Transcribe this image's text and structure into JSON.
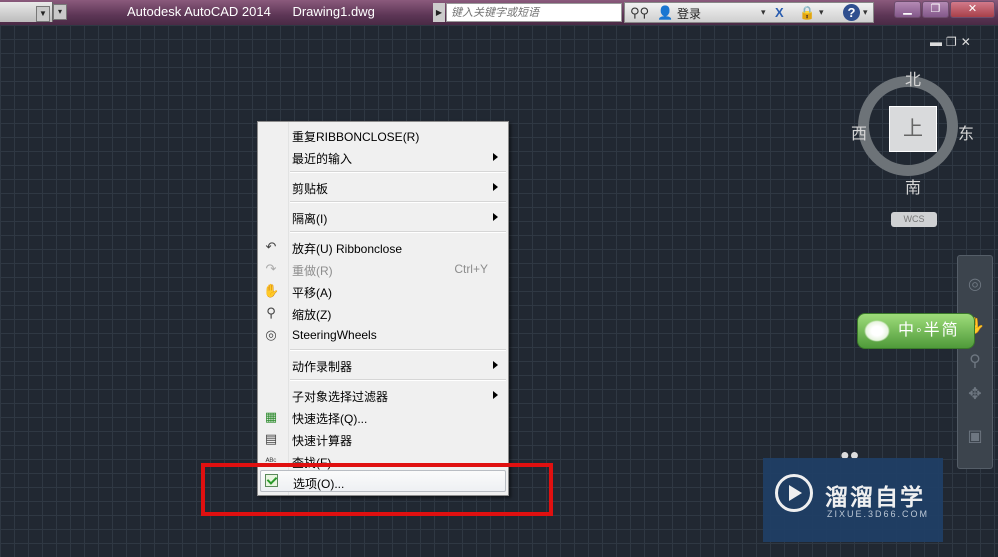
{
  "titlebar": {
    "app_name": "Autodesk AutoCAD 2014",
    "document": "Drawing1.dwg",
    "search_placeholder": "键入关键字或短语",
    "login_label": "登录",
    "help_icon": "?"
  },
  "icons": {
    "binoculars": "binoculars-icon",
    "user": "user-icon",
    "exchange": "x-icon",
    "app_store": "cart-icon",
    "help": "help-icon"
  },
  "viewcube": {
    "north": "北",
    "south": "南",
    "east": "东",
    "west": "西",
    "face": "上",
    "wcs_label": "WCS"
  },
  "ime": {
    "label": "中◦半简"
  },
  "watermark": {
    "title": "溜溜自学",
    "subtitle": "ZIXUE.3D66.COM"
  },
  "context_menu": {
    "items": [
      {
        "label": "重复RIBBONCLOSE(R)"
      },
      {
        "label": "最近的输入"
      },
      {
        "label": "剪贴板"
      },
      {
        "label": "隔离(I)"
      },
      {
        "label": "放弃(U) Ribbonclose"
      },
      {
        "label": "重做(R)",
        "shortcut": "Ctrl+Y"
      },
      {
        "label": "平移(A)"
      },
      {
        "label": "缩放(Z)"
      },
      {
        "label": "SteeringWheels"
      },
      {
        "label": "动作录制器"
      },
      {
        "label": "子对象选择过滤器"
      },
      {
        "label": "快速选择(Q)..."
      },
      {
        "label": "快速计算器"
      },
      {
        "label": "查找(F)..."
      },
      {
        "label": "选项(O)..."
      }
    ]
  },
  "colors": {
    "highlight": "#e01010",
    "canvas": "#212832"
  }
}
